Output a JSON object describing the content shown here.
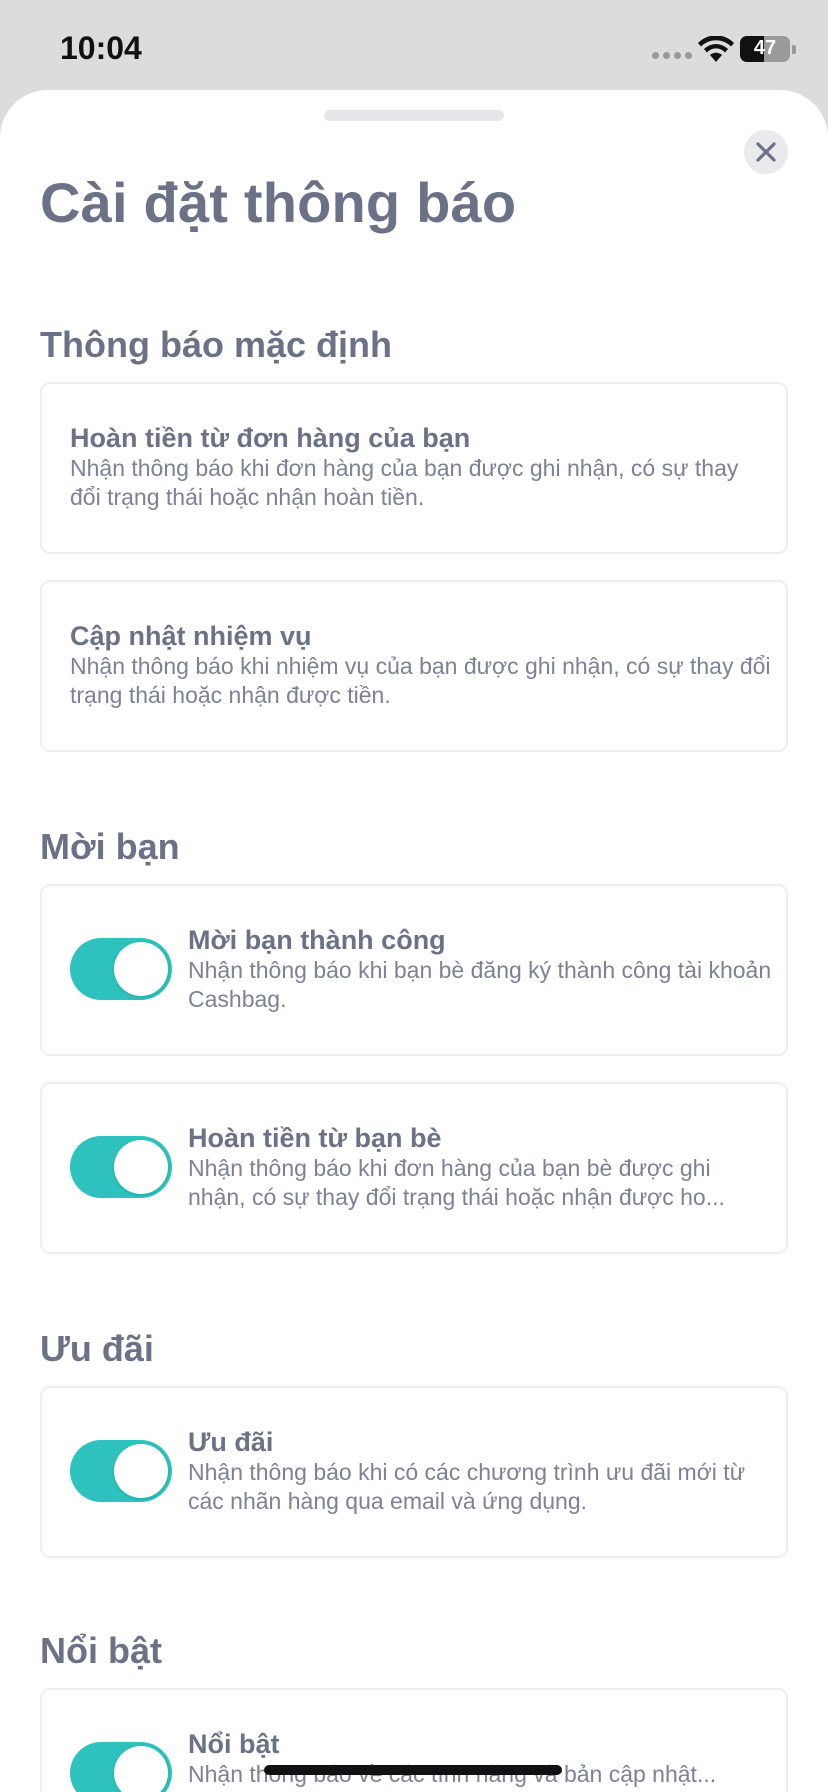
{
  "status_bar": {
    "time": "10:04",
    "battery": "47",
    "battery_level": 0.47
  },
  "header": {
    "title": "Cài đặt thông báo",
    "close_icon": "close-icon"
  },
  "sections": [
    {
      "title": "Thông báo mặc định",
      "items": [
        {
          "title": "Hoàn tiền từ đơn hàng của bạn",
          "description": "Nhận thông báo khi đơn hàng của bạn được ghi nhận, có sự thay đổi trạng thái hoặc nhận hoàn tiền."
        },
        {
          "title": "Cập nhật nhiệm vụ",
          "description": "Nhận thông báo khi nhiệm vụ của bạn được ghi nhận, có sự thay đổi trạng thái hoặc nhận được tiền."
        }
      ]
    },
    {
      "title": "Mời bạn",
      "items": [
        {
          "title": "Mời bạn thành công",
          "description": "Nhận thông báo khi bạn bè đăng ký thành công tài khoản Cashbag.",
          "enabled": true
        },
        {
          "title": "Hoàn tiền từ bạn bè",
          "description": "Nhận thông báo khi đơn hàng của bạn bè được ghi nhận, có sự thay đổi trạng thái hoặc nhận được ho...",
          "enabled": true
        }
      ]
    },
    {
      "title": "Ưu đãi",
      "items": [
        {
          "title": "Ưu đãi",
          "description": "Nhận thông báo khi có các chương trình ưu đãi mới từ các nhãn hàng qua email và ứng dụng.",
          "enabled": true
        }
      ]
    },
    {
      "title": "Nổi bật",
      "items": [
        {
          "title": "Nổi bật",
          "description": "Nhận thông báo về các tính năng và bản cập nhật...",
          "enabled": true
        }
      ]
    }
  ],
  "colors": {
    "accent": "#2dc2bd",
    "text": "#6b7288",
    "border": "#eeeef1"
  }
}
